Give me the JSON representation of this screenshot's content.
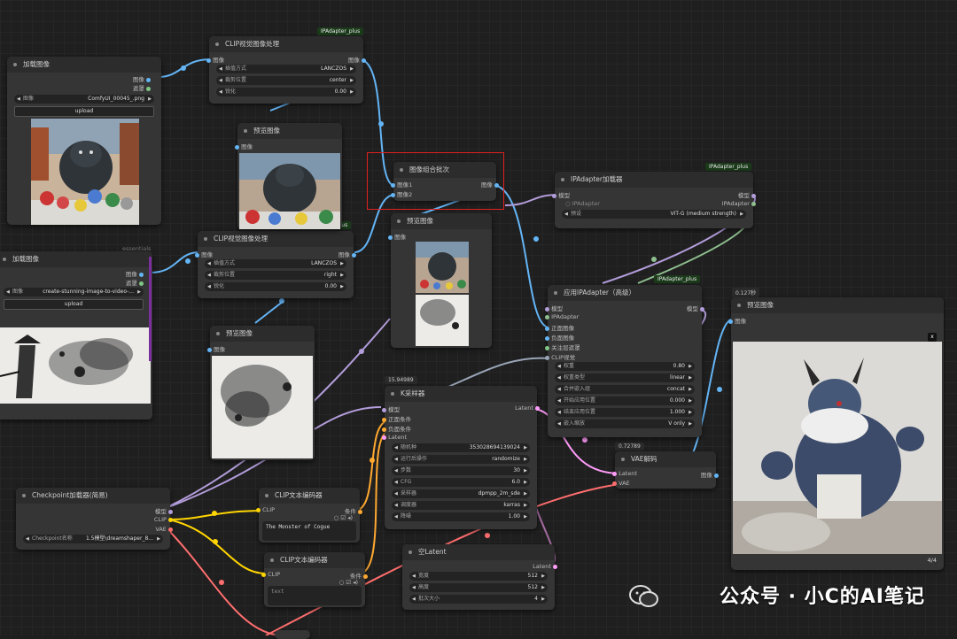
{
  "badges": {
    "ipa1": "IPAdapter_plus",
    "ipa2": "IPAdapter_plus",
    "ipa3": "IPAdapter_plus",
    "ipa4": "IPAdapter_plus",
    "essentials": "essentials"
  },
  "times": {
    "ksampler": "15.94989",
    "vae": "0.72789",
    "preview": "0.127秒"
  },
  "load1": {
    "title": "加载图像",
    "out_image": "图像",
    "out_mask": "遮罩",
    "file_label": "图像",
    "file": "ComfyUI_00045_.png",
    "upload": "upload"
  },
  "load2": {
    "title": "加载图像",
    "out_image": "图像",
    "out_mask": "遮罩",
    "file_label": "图像",
    "file": "create-stunning-image-to-video-...",
    "upload": "upload"
  },
  "clipvis1": {
    "title": "CLIP视觉图像处理",
    "in": "图像",
    "out": "图像",
    "w1l": "插值方式",
    "w1v": "LANCZOS",
    "w2l": "裁剪位置",
    "w2v": "center",
    "w3l": "锐化",
    "w3v": "0.00"
  },
  "clipvis2": {
    "title": "CLIP视觉图像处理",
    "in": "图像",
    "out": "图像",
    "w1l": "插值方式",
    "w1v": "LANCZOS",
    "w2l": "裁剪位置",
    "w2v": "right",
    "w3l": "锐化",
    "w3v": "0.00"
  },
  "preview1": {
    "title": "预览图像",
    "in": "图像"
  },
  "preview2": {
    "title": "预览图像",
    "in": "图像"
  },
  "preview3": {
    "title": "预览图像",
    "in": "图像"
  },
  "preview4": {
    "title": "预览图像",
    "in": "图像",
    "counter": "4/4",
    "close": "x"
  },
  "batch": {
    "title": "图像组合批次",
    "in1": "图像1",
    "in2": "图像2",
    "out": "图像"
  },
  "ipaload": {
    "title": "IPAdapter加载器",
    "in": "模型",
    "out1": "模型",
    "out2": "IPAdapter",
    "wl": "预设",
    "wv": "VIT-G (medium strength)"
  },
  "ipaadv": {
    "title": "应用IPAdapter（高级）",
    "inputs": [
      "模型",
      "IPAdapter",
      "正面图像",
      "负面图像",
      "关注层遮罩",
      "CLIP视觉"
    ],
    "out": "模型",
    "widgets": [
      {
        "l": "权重",
        "v": "0.80"
      },
      {
        "l": "权重类型",
        "v": "linear"
      },
      {
        "l": "合并嵌入组",
        "v": "concat"
      },
      {
        "l": "开始应用位置",
        "v": "0.000"
      },
      {
        "l": "结束应用位置",
        "v": "1.000"
      },
      {
        "l": "嵌入缩放",
        "v": "V only"
      }
    ]
  },
  "ksampler": {
    "title": "K采样器",
    "inputs": [
      "模型",
      "正面条件",
      "负面条件",
      "Latent"
    ],
    "out": "Latent",
    "widgets": [
      {
        "l": "随机种",
        "v": "353028694139024"
      },
      {
        "l": "运行后操作",
        "v": "randomize"
      },
      {
        "l": "步数",
        "v": "30"
      },
      {
        "l": "CFG",
        "v": "6.0"
      },
      {
        "l": "采样器",
        "v": "dpmpp_2m_sde"
      },
      {
        "l": "调度器",
        "v": "karras"
      },
      {
        "l": "降噪",
        "v": "1.00"
      }
    ]
  },
  "vae": {
    "title": "VAE解码",
    "in1": "Latent",
    "in2": "VAE",
    "out": "图像"
  },
  "ckpt": {
    "title": "Checkpoint加载器(简易)",
    "out1": "模型",
    "out2": "CLIP",
    "out3": "VAE",
    "wl": "Checkpoint名称",
    "wv": "1.5模型\\dreamshaper_8..."
  },
  "clippos": {
    "title": "CLIP文本编码器",
    "in": "CLIP",
    "out": "条件",
    "text": "The Monster of Cogue"
  },
  "clipneg": {
    "title": "CLIP文本编码器",
    "in": "CLIP",
    "out": "条件",
    "text": "text"
  },
  "emptylat": {
    "title": "空Latent",
    "out": "Latent",
    "widgets": [
      {
        "l": "宽度",
        "v": "512"
      },
      {
        "l": "高度",
        "v": "512"
      },
      {
        "l": "批次大小",
        "v": "4"
      }
    ]
  },
  "watermark": "公众号 · 小C的AI笔记",
  "colors": {
    "image": "#64b5f6",
    "mask": "#81c784",
    "model": "#b39ddb",
    "clip": "#ffd500",
    "latent": "#ff9cf9",
    "vae": "#ff6e6e",
    "cond": "#ffa931",
    "ipadapter": "#8fbf8f"
  }
}
